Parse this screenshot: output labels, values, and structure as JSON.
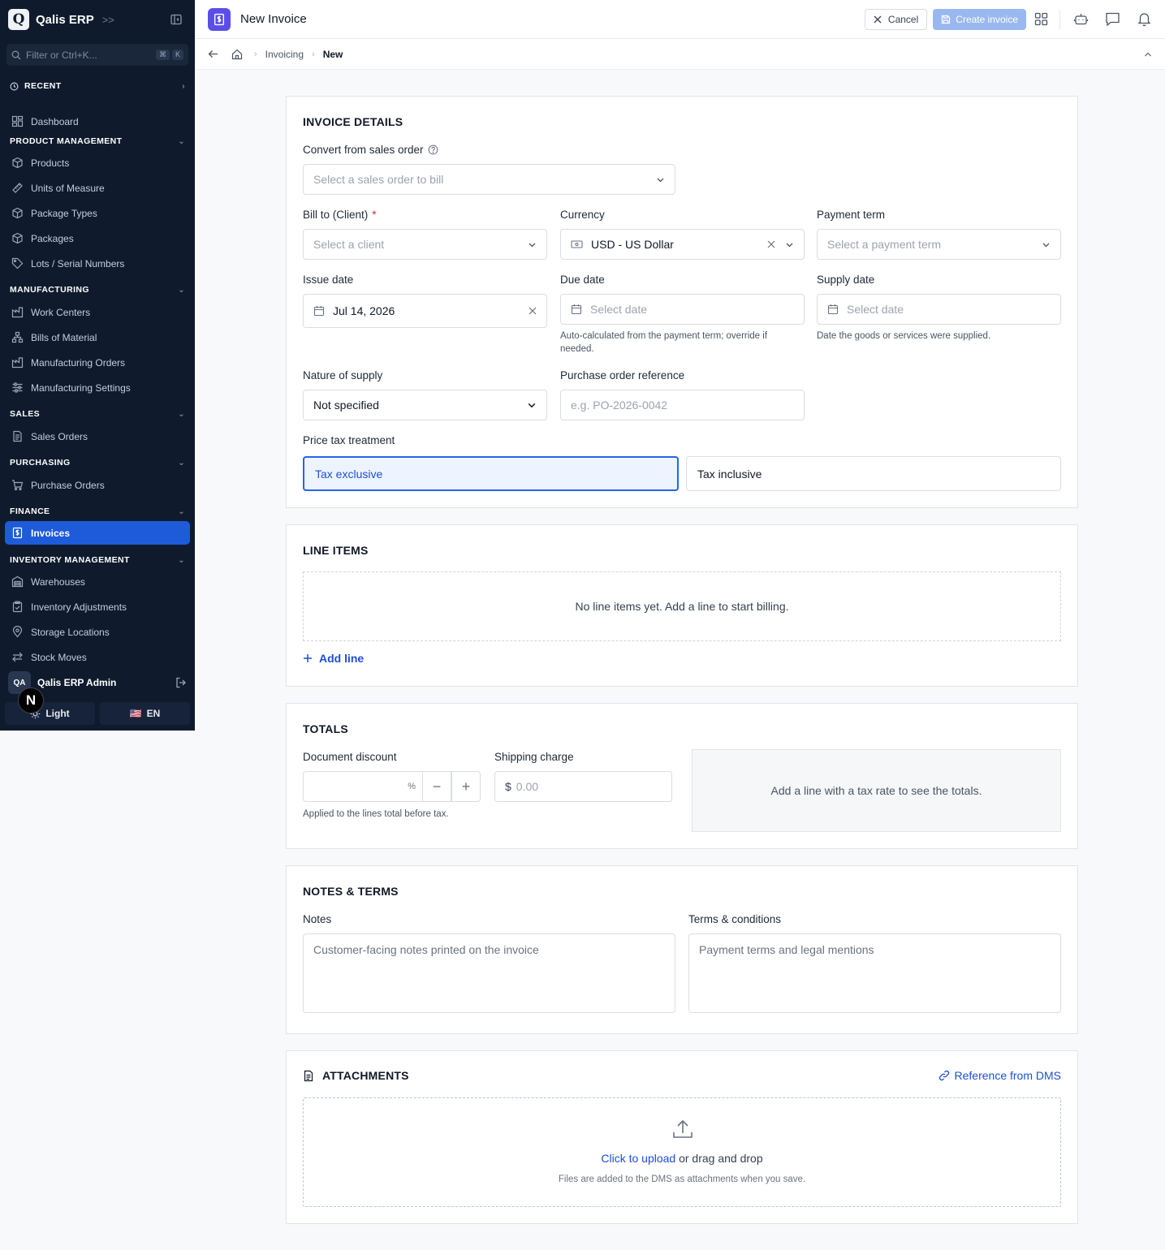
{
  "app": {
    "name": "Qalis ERP",
    "logo_letter": "Q",
    "search_placeholder": "Filter or Ctrl+K...",
    "search_kbd": [
      "⌘",
      "K"
    ]
  },
  "sidebar": {
    "recent_label": "RECENT",
    "dashboard_label": "Dashboard",
    "sections": {
      "product": "PRODUCT MANAGEMENT",
      "manufacturing": "MANUFACTURING",
      "sales": "SALES",
      "purchasing": "PURCHASING",
      "finance": "FINANCE",
      "inventory": "INVENTORY MANAGEMENT"
    },
    "items": {
      "products": "Products",
      "uom": "Units of Measure",
      "package_types": "Package Types",
      "packages": "Packages",
      "lots": "Lots / Serial Numbers",
      "work_centers": "Work Centers",
      "bom": "Bills of Material",
      "mo": "Manufacturing Orders",
      "mfg_settings": "Manufacturing Settings",
      "sales_orders": "Sales Orders",
      "purchase_orders": "Purchase Orders",
      "invoices": "Invoices",
      "warehouses": "Warehouses",
      "inv_adjust": "Inventory Adjustments",
      "storage": "Storage Locations",
      "stock_moves": "Stock Moves"
    },
    "user": {
      "initials": "QA",
      "name": "Qalis ERP Admin"
    },
    "theme_label": "Light",
    "lang_flag": "🇺🇸",
    "lang_label": "EN",
    "n_badge": "N"
  },
  "header": {
    "title": "New Invoice",
    "cancel_label": "Cancel",
    "create_label": "Create invoice"
  },
  "breadcrumb": {
    "parent": "Invoicing",
    "current": "New"
  },
  "details": {
    "heading": "INVOICE DETAILS",
    "convert_label": "Convert from sales order",
    "convert_placeholder": "Select a sales order to bill",
    "bill_to_label": "Bill to (Client)",
    "bill_to_placeholder": "Select a client",
    "currency_label": "Currency",
    "currency_value": "USD - US Dollar",
    "payment_term_label": "Payment term",
    "payment_term_placeholder": "Select a payment term",
    "issue_date_label": "Issue date",
    "issue_date_value": "Jul 14, 2026",
    "due_date_label": "Due date",
    "due_date_placeholder": "Select date",
    "due_date_help": "Auto-calculated from the payment term; override if needed.",
    "supply_date_label": "Supply date",
    "supply_date_placeholder": "Select date",
    "supply_date_help": "Date the goods or services were supplied.",
    "nature_label": "Nature of supply",
    "nature_value": "Not specified",
    "po_ref_label": "Purchase order reference",
    "po_ref_placeholder": "e.g. PO-2026-0042",
    "tax_label": "Price tax treatment",
    "tax_exclusive": "Tax exclusive",
    "tax_inclusive": "Tax inclusive",
    "tax_selected": "exclusive"
  },
  "line_items": {
    "heading": "LINE ITEMS",
    "empty": "No line items yet. Add a line to start billing.",
    "add_label": "Add line"
  },
  "totals": {
    "heading": "TOTALS",
    "discount_label": "Document discount",
    "discount_unit": "%",
    "discount_help": "Applied to the lines total before tax.",
    "shipping_label": "Shipping charge",
    "shipping_currency": "$",
    "shipping_placeholder": "0.00",
    "empty": "Add a line with a tax rate to see the totals."
  },
  "notes": {
    "heading": "NOTES & TERMS",
    "notes_label": "Notes",
    "notes_placeholder": "Customer-facing notes printed on the invoice",
    "terms_label": "Terms & conditions",
    "terms_placeholder": "Payment terms and legal mentions"
  },
  "attachments": {
    "heading": "ATTACHMENTS",
    "dms_link": "Reference from DMS",
    "upload_link": "Click to upload",
    "upload_rest": " or drag and drop",
    "upload_help": "Files are added to the DMS as attachments when you save."
  },
  "colors": {
    "sidebar_bg": "#0f1b2d",
    "accent": "#1e5bd8",
    "page_icon": "#5b4de8"
  }
}
